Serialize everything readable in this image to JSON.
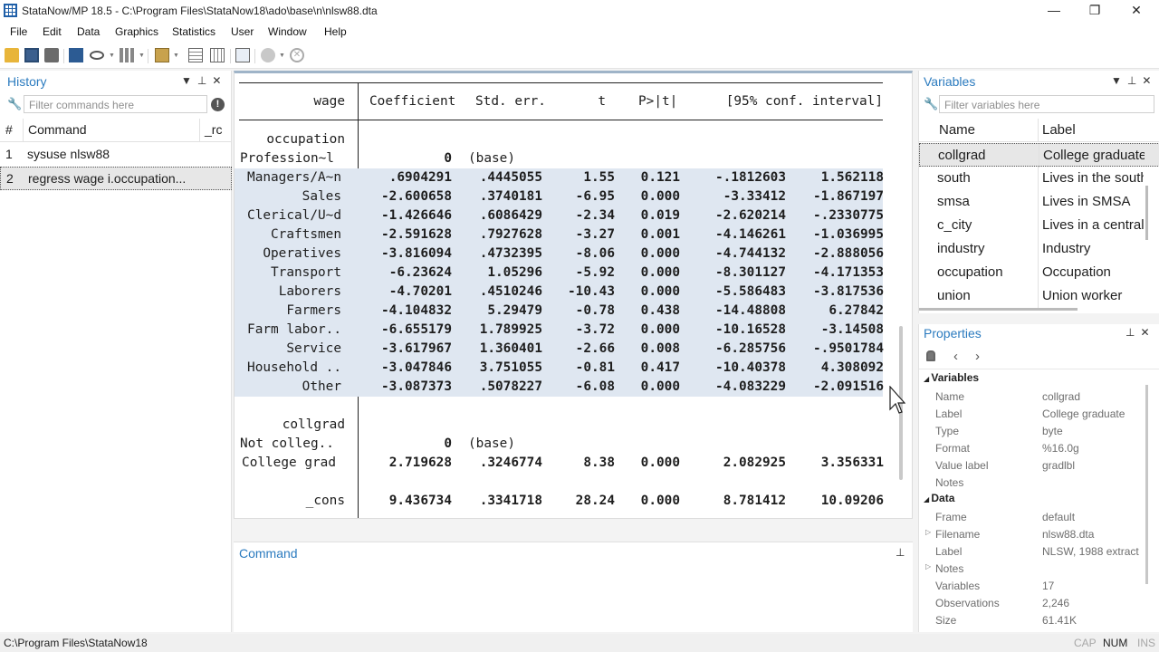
{
  "window": {
    "title": "StataNow/MP 18.5 - C:\\Program Files\\StataNow18\\ado\\base\\n\\nlsw88.dta",
    "controls": {
      "minimize": "—",
      "restore": "❐",
      "close": "✕"
    }
  },
  "menu": [
    "File",
    "Edit",
    "Data",
    "Graphics",
    "Statistics",
    "User",
    "Window",
    "Help"
  ],
  "history": {
    "title": "History",
    "filter_placeholder": "Filter commands here",
    "col_num": "#",
    "col_cmd": "Command",
    "col_rc": "_rc",
    "items": [
      {
        "num": "1",
        "cmd": "sysuse nlsw88"
      },
      {
        "num": "2",
        "cmd": "regress wage i.occupation..."
      }
    ]
  },
  "results": {
    "header": {
      "depvar": "wage",
      "coef": "Coefficient",
      "se": "Std. err.",
      "t": "t",
      "p": "P>|t|",
      "ci": "[95% conf. interval]"
    },
    "groups": [
      {
        "name": "occupation",
        "base": {
          "label": "Profession~l",
          "zero": "0",
          "base_text": "(base)"
        },
        "rows": [
          {
            "label": "Managers/A~n",
            "coef": ".6904291",
            "se": ".4445055",
            "t": "1.55",
            "p": "0.121",
            "lo": "-.1812603",
            "hi": "1.562118"
          },
          {
            "label": "Sales",
            "coef": "-2.600658",
            "se": ".3740181",
            "t": "-6.95",
            "p": "0.000",
            "lo": "-3.33412",
            "hi": "-1.867197"
          },
          {
            "label": "Clerical/U~d",
            "coef": "-1.426646",
            "se": ".6086429",
            "t": "-2.34",
            "p": "0.019",
            "lo": "-2.620214",
            "hi": "-.2330775"
          },
          {
            "label": "Craftsmen",
            "coef": "-2.591628",
            "se": ".7927628",
            "t": "-3.27",
            "p": "0.001",
            "lo": "-4.146261",
            "hi": "-1.036995"
          },
          {
            "label": "Operatives",
            "coef": "-3.816094",
            "se": ".4732395",
            "t": "-8.06",
            "p": "0.000",
            "lo": "-4.744132",
            "hi": "-2.888056"
          },
          {
            "label": "Transport",
            "coef": "-6.23624",
            "se": "1.05296",
            "t": "-5.92",
            "p": "0.000",
            "lo": "-8.301127",
            "hi": "-4.171353"
          },
          {
            "label": "Laborers",
            "coef": "-4.70201",
            "se": ".4510246",
            "t": "-10.43",
            "p": "0.000",
            "lo": "-5.586483",
            "hi": "-3.817536"
          },
          {
            "label": "Farmers",
            "coef": "-4.104832",
            "se": "5.29479",
            "t": "-0.78",
            "p": "0.438",
            "lo": "-14.48808",
            "hi": "6.27842"
          },
          {
            "label": "Farm labor..",
            "coef": "-6.655179",
            "se": "1.789925",
            "t": "-3.72",
            "p": "0.000",
            "lo": "-10.16528",
            "hi": "-3.14508"
          },
          {
            "label": "Service",
            "coef": "-3.617967",
            "se": "1.360401",
            "t": "-2.66",
            "p": "0.008",
            "lo": "-6.285756",
            "hi": "-.9501784"
          },
          {
            "label": "Household ..",
            "coef": "-3.047846",
            "se": "3.751055",
            "t": "-0.81",
            "p": "0.417",
            "lo": "-10.40378",
            "hi": "4.308092"
          },
          {
            "label": "Other",
            "coef": "-3.087373",
            "se": ".5078227",
            "t": "-6.08",
            "p": "0.000",
            "lo": "-4.083229",
            "hi": "-2.091516"
          }
        ]
      },
      {
        "name": "collgrad",
        "base": {
          "label": "Not colleg..",
          "zero": "0",
          "base_text": "(base)"
        },
        "rows": [
          {
            "label": "College grad",
            "coef": "2.719628",
            "se": ".3246774",
            "t": "8.38",
            "p": "0.000",
            "lo": "2.082925",
            "hi": "3.356331"
          }
        ]
      }
    ],
    "cons": {
      "label": "_cons",
      "coef": "9.436734",
      "se": ".3341718",
      "t": "28.24",
      "p": "0.000",
      "lo": "8.781412",
      "hi": "10.09206"
    }
  },
  "command": {
    "title": "Command"
  },
  "variables": {
    "title": "Variables",
    "filter_placeholder": "Filter variables here",
    "col_name": "Name",
    "col_label": "Label",
    "items": [
      {
        "name": "collgrad",
        "label": "College graduate"
      },
      {
        "name": "south",
        "label": "Lives in the south"
      },
      {
        "name": "smsa",
        "label": "Lives in SMSA"
      },
      {
        "name": "c_city",
        "label": "Lives in a central city"
      },
      {
        "name": "industry",
        "label": "Industry"
      },
      {
        "name": "occupation",
        "label": "Occupation"
      },
      {
        "name": "union",
        "label": "Union worker"
      }
    ]
  },
  "properties": {
    "title": "Properties",
    "variables_section": "Variables",
    "var_props": [
      {
        "key": "Name",
        "val": "collgrad"
      },
      {
        "key": "Label",
        "val": "College graduate"
      },
      {
        "key": "Type",
        "val": "byte"
      },
      {
        "key": "Format",
        "val": "%16.0g"
      },
      {
        "key": "Value label",
        "val": "gradlbl"
      },
      {
        "key": "Notes",
        "val": ""
      }
    ],
    "data_section": "Data",
    "data_props": [
      {
        "key": "Frame",
        "val": "default"
      },
      {
        "key": "Filename",
        "val": "nlsw88.dta"
      },
      {
        "key": "Label",
        "val": "NLSW, 1988 extract"
      },
      {
        "key": "Notes",
        "val": ""
      },
      {
        "key": "Variables",
        "val": "17"
      },
      {
        "key": "Observations",
        "val": "2,246"
      },
      {
        "key": "Size",
        "val": "61.41K"
      }
    ]
  },
  "statusbar": {
    "path": "C:\\Program Files\\StataNow18",
    "cap": "CAP",
    "num": "NUM",
    "ins": "INS"
  }
}
